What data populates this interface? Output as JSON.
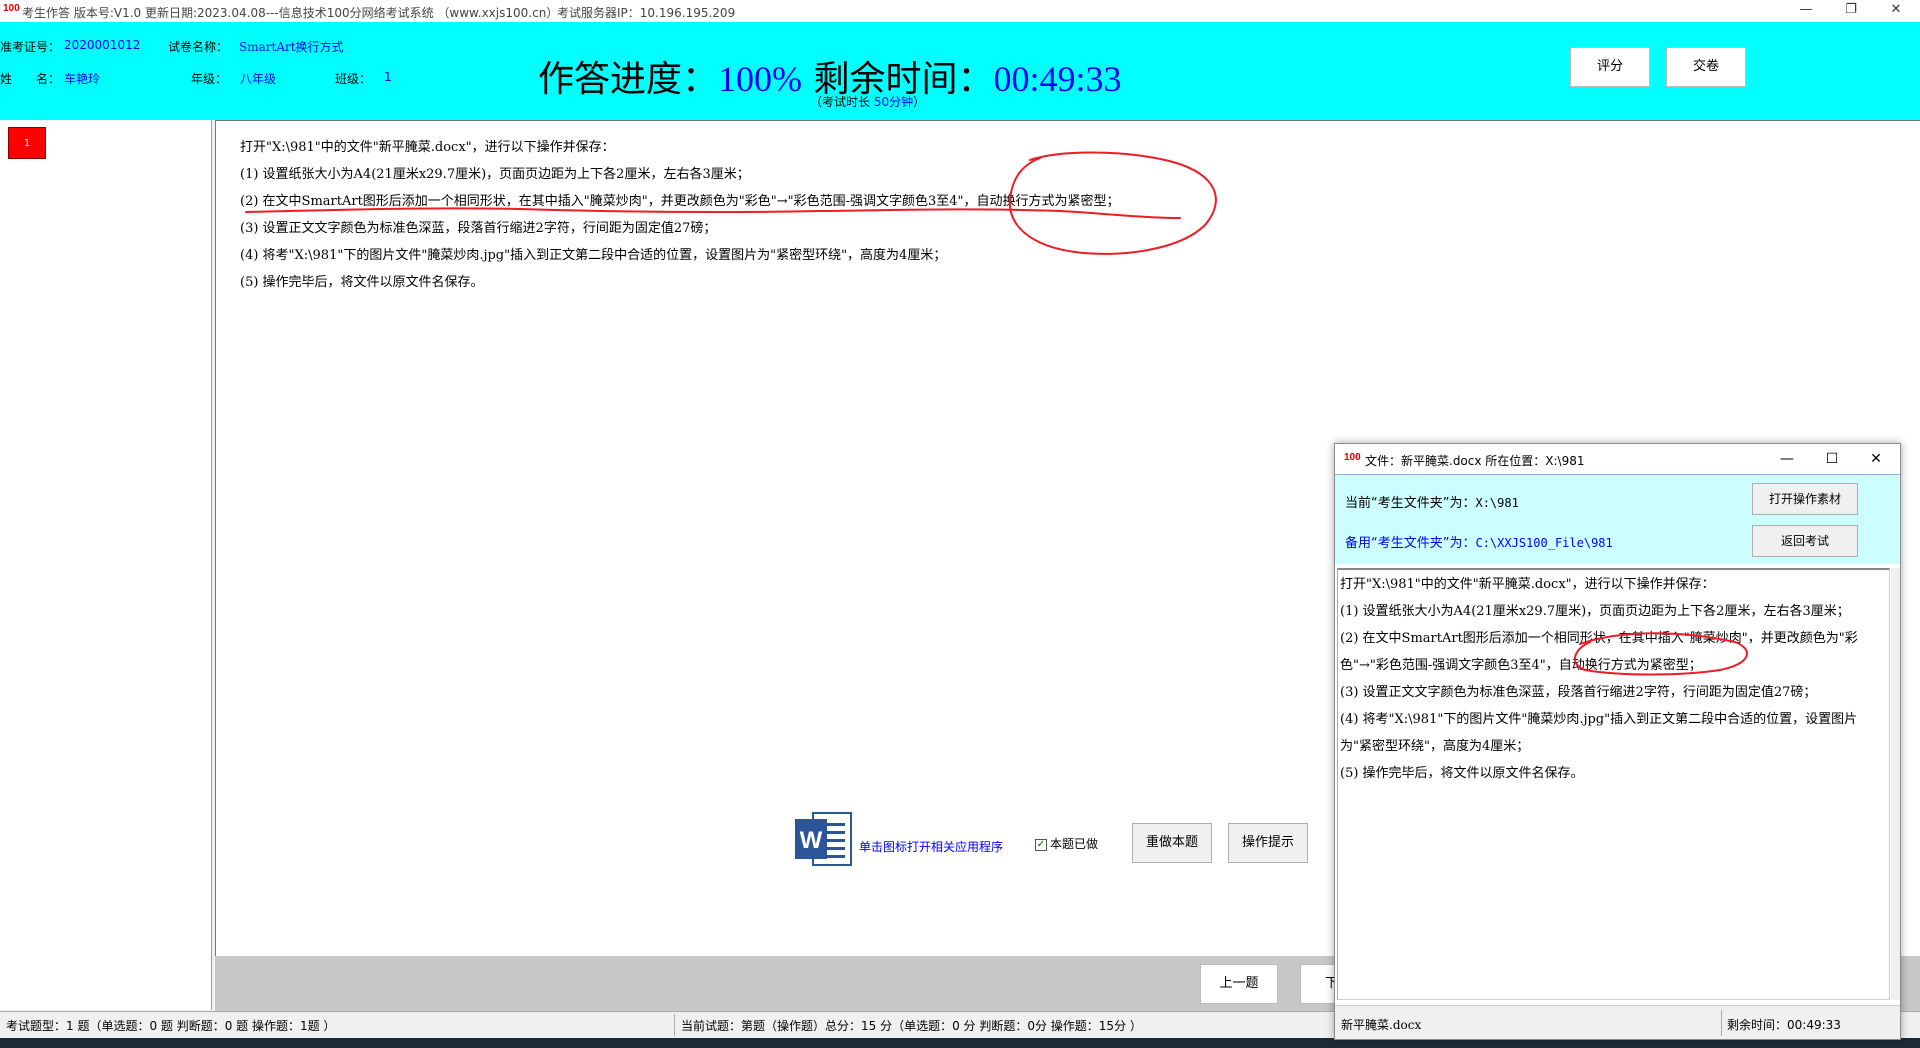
{
  "titlebar": {
    "title": "考生作答 版本号:V1.0 更新日期:2023.04.08---信息技术100分网络考试系统 （www.xxjs100.cn）",
    "server": "考试服务器IP：10.196.195.209",
    "logo_text": "100",
    "min_glyph": "—",
    "max_glyph": "❐",
    "close_glyph": "✕"
  },
  "header": {
    "exam_id_label": "准考证号：",
    "exam_id": "2020001012",
    "paper_label": "试卷名称：",
    "paper_name": "SmartArt换行方式",
    "name_label": "姓　　名：",
    "name": "车艳玲",
    "grade_label": "年级：",
    "grade": "八年级",
    "class_label": "班级：",
    "class": "1",
    "progress_label": "作答进度：",
    "progress_value": "100%",
    "remaining_label": " 剩余时间：",
    "remaining_value": "00:49:33",
    "duration_prefix": "（考试时长 ",
    "duration_value": "50分钟",
    "duration_suffix": "）",
    "score_btn": "评分",
    "submit_btn": "交卷"
  },
  "left": {
    "question_number": "1"
  },
  "question": {
    "lines": [
      "打开\"X:\\981\"中的文件\"新平腌菜.docx\"，进行以下操作并保存：",
      "(1) 设置纸张大小为A4(21厘米x29.7厘米)，页面页边距为上下各2厘米，左右各3厘米；",
      "(2) 在文中SmartArt图形后添加一个相同形状，在其中插入\"腌菜炒肉\"，并更改颜色为\"彩色\"→\"彩色范围-强调文字颜色3至4\"，自动换行方式为紧密型；",
      "(3) 设置正文文字颜色为标准色深蓝，段落首行缩进2字符，行间距为固定值27磅；",
      "(4) 将考\"X:\\981\"下的图片文件\"腌菜炒肉.jpg\"插入到正文第二段中合适的位置，设置图片为\"紧密型环绕\"，高度为4厘米；",
      "(5) 操作完毕后，将文件以原文件名保存。"
    ]
  },
  "actions": {
    "word_hint": "单击图标打开相关应用程序",
    "done_label": "本题已做",
    "done_checked": true,
    "redo_btn": "重做本题",
    "tip_btn": "操作提示",
    "prev_btn": "上一题",
    "next_btn": "下一题"
  },
  "statusbar": {
    "left": "考试题型：1 题（单选题：0 题 判断题：0 题 操作题：1题 ）",
    "mid": "当前试题：第题（操作题）总分：15 分（单选题：0 分 判断题：0分 操作题：15分 ）"
  },
  "float_window": {
    "title": "文件：新平腌菜.docx 所在位置：X:\\981",
    "current_folder_label": "当前“考生文件夹”为：",
    "current_folder": "X:\\981",
    "backup_folder_label": "备用“考生文件夹”为：",
    "backup_folder": "C:\\XXJS100_File\\981",
    "open_btn": "打开操作素材",
    "return_btn": "返回考试",
    "lines": [
      "打开\"X:\\981\"中的文件\"新平腌菜.docx\"，进行以下操作并保存：",
      " (1) 设置纸张大小为A4(21厘米x29.7厘米)，页面页边距为上下各2厘米，左右各3厘米；",
      " (2) 在文中SmartArt图形后添加一个相同形状，在其中插入\"腌菜炒肉\"，并更改颜色为\"彩",
      "色\"→\"彩色范围-强调文字颜色3至4\"，自动换行方式为紧密型；",
      " (3) 设置正文文字颜色为标准色深蓝，段落首行缩进2字符，行间距为固定值27磅；",
      " (4) 将考\"X:\\981\"下的图片文件\"腌菜炒肉.jpg\"插入到正文第二段中合适的位置，设置图片",
      "为\"紧密型环绕\"，高度为4厘米；",
      " (5) 操作完毕后，将文件以原文件名保存。"
    ],
    "status_file": "新平腌菜.docx",
    "status_remaining": "剩余时间：00:49:33"
  },
  "colors": {
    "header_bg": "#00ffff",
    "float_header_bg": "#ccffff",
    "accent_blue": "#0000ff",
    "question_marker": "#ff0000",
    "annotation": "#ee1c24"
  }
}
